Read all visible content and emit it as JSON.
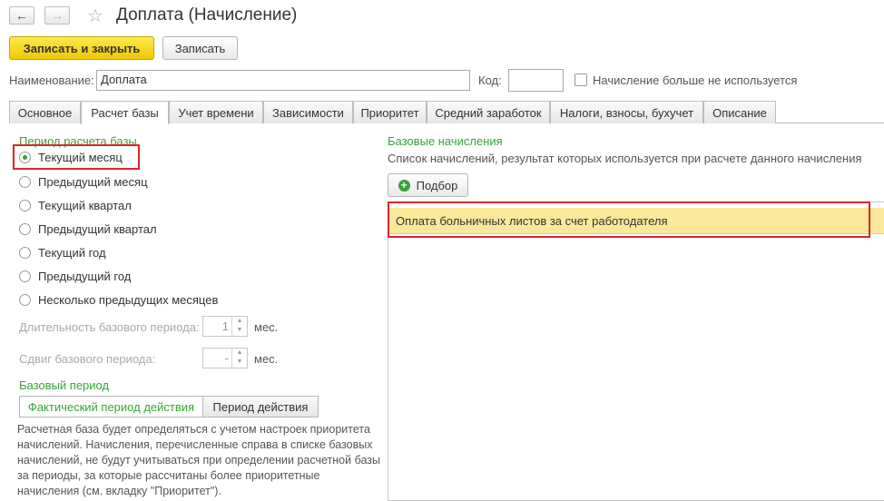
{
  "header": {
    "back_icon": "arrow-left-icon",
    "forward_icon": "arrow-right-icon",
    "favorite_icon": "star-icon",
    "title": "Доплата (Начисление)"
  },
  "toolbar": {
    "save_close_label": "Записать и закрыть",
    "save_label": "Записать"
  },
  "form": {
    "name_label": "Наименование:",
    "name_value": "Доплата",
    "code_label": "Код:",
    "code_value": "",
    "unused_label": "Начисление больше не используется"
  },
  "tabs": [
    {
      "label": "Основное"
    },
    {
      "label": "Расчет базы"
    },
    {
      "label": "Учет времени"
    },
    {
      "label": "Зависимости"
    },
    {
      "label": "Приоритет"
    },
    {
      "label": "Средний заработок"
    },
    {
      "label": "Налоги, взносы, бухучет"
    },
    {
      "label": "Описание"
    }
  ],
  "period": {
    "group_title": "Период расчета базы",
    "options": [
      {
        "label": "Текущий месяц",
        "checked": true
      },
      {
        "label": "Предыдущий месяц",
        "checked": false
      },
      {
        "label": "Текущий квартал",
        "checked": false
      },
      {
        "label": "Предыдущий квартал",
        "checked": false
      },
      {
        "label": "Текущий год",
        "checked": false
      },
      {
        "label": "Предыдущий год",
        "checked": false
      },
      {
        "label": "Несколько предыдущих месяцев",
        "checked": false
      }
    ],
    "duration_label": "Длительность базового периода:",
    "duration_value": "1",
    "duration_unit": "мес.",
    "shift_label": "Сдвиг базового периода:",
    "shift_value": "-",
    "shift_unit": "мес."
  },
  "base_period": {
    "group_title": "Базовый период",
    "option_actual": "Фактический период действия",
    "option_period": "Период действия",
    "description": "Расчетная база будет определяться с учетом настроек приоритета начислений. Начисления, перечисленные справа в списке базовых начислений, не будут учитываться при определении расчетной базы за периоды, за которые рассчитаны более приоритетные начисления (см. вкладку \"Приоритет\")."
  },
  "base_accruals": {
    "group_title": "Базовые начисления",
    "subtitle": "Список начислений, результат которых используется при расчете данного начисления",
    "pick_icon": "plus-circle-icon",
    "pick_label": "Подбор",
    "rows": [
      {
        "name": "Оплата больничных листов за счет работодателя"
      }
    ]
  },
  "colors": {
    "accent_green": "#3aa13a",
    "highlight_red": "#d9262e",
    "primary_yellow": "#f1c800",
    "selected_row": "#fbe89a"
  }
}
